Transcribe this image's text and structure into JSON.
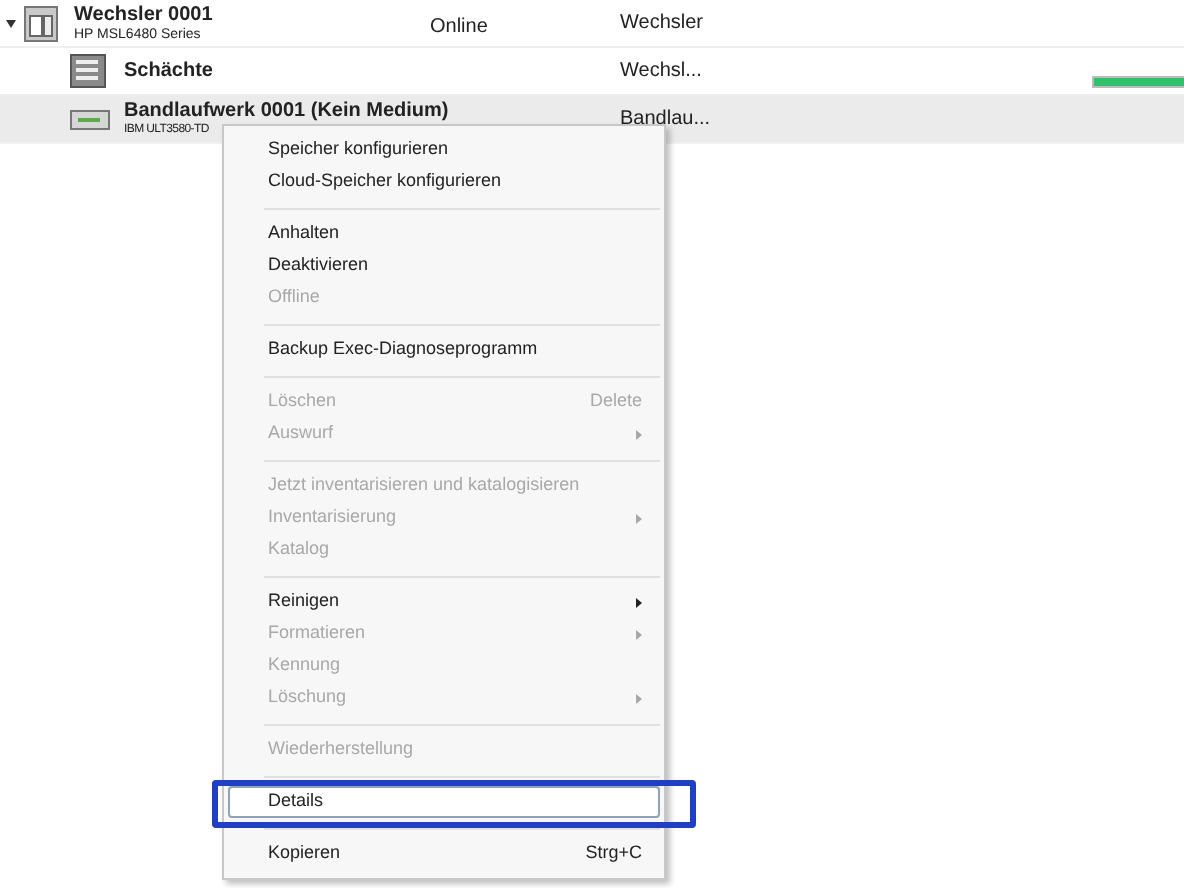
{
  "rows": [
    {
      "kind": "changer",
      "title": "Wechsler 0001",
      "subtitle": "HP MSL6480 Series",
      "status": "Online",
      "type": "Wechsler",
      "expanded": true,
      "selected": false
    },
    {
      "kind": "slots",
      "title": "Schächte",
      "type": "Wechsl...",
      "selected": false,
      "progress": {
        "level": 1
      }
    },
    {
      "kind": "drive",
      "title": "Bandlaufwerk 0001 (Kein Medium)",
      "subtitle": "IBM ULT3580-TD",
      "type": "Bandlau...",
      "selected": true
    }
  ],
  "context_menu": {
    "groups": [
      [
        {
          "label": "Speicher konfigurieren",
          "disabled": false,
          "selected": false
        },
        {
          "label": "Cloud-Speicher konfigurieren",
          "disabled": false,
          "selected": false
        }
      ],
      [
        {
          "label": "Anhalten",
          "disabled": false,
          "selected": false
        },
        {
          "label": "Deaktivieren",
          "disabled": false,
          "selected": false
        },
        {
          "label": "Offline",
          "disabled": true,
          "selected": false
        }
      ],
      [
        {
          "label": "Backup Exec-Diagnoseprogramm",
          "disabled": false,
          "selected": false
        }
      ],
      [
        {
          "label": "Löschen",
          "shortcut": "Delete",
          "disabled": true,
          "selected": false
        },
        {
          "label": "Auswurf",
          "submenu": true,
          "disabled": true,
          "selected": false
        }
      ],
      [
        {
          "label": "Jetzt inventarisieren und katalogisieren",
          "disabled": true,
          "selected": false
        },
        {
          "label": "Inventarisierung",
          "submenu": true,
          "disabled": true,
          "selected": false
        },
        {
          "label": "Katalog",
          "disabled": true,
          "selected": false
        }
      ],
      [
        {
          "label": "Reinigen",
          "submenu": true,
          "disabled": false,
          "selected": false
        },
        {
          "label": "Formatieren",
          "submenu": true,
          "disabled": true,
          "selected": false
        },
        {
          "label": "Kennung",
          "disabled": true,
          "selected": false
        },
        {
          "label": "Löschung",
          "submenu": true,
          "disabled": true,
          "selected": false
        }
      ],
      [
        {
          "label": "Wiederherstellung",
          "disabled": true,
          "selected": false
        }
      ],
      [
        {
          "label": "Details",
          "disabled": false,
          "selected": true,
          "highlighted": true
        }
      ],
      [
        {
          "label": "Kopieren",
          "shortcut": "Strg+C",
          "disabled": false,
          "selected": false
        }
      ]
    ]
  }
}
